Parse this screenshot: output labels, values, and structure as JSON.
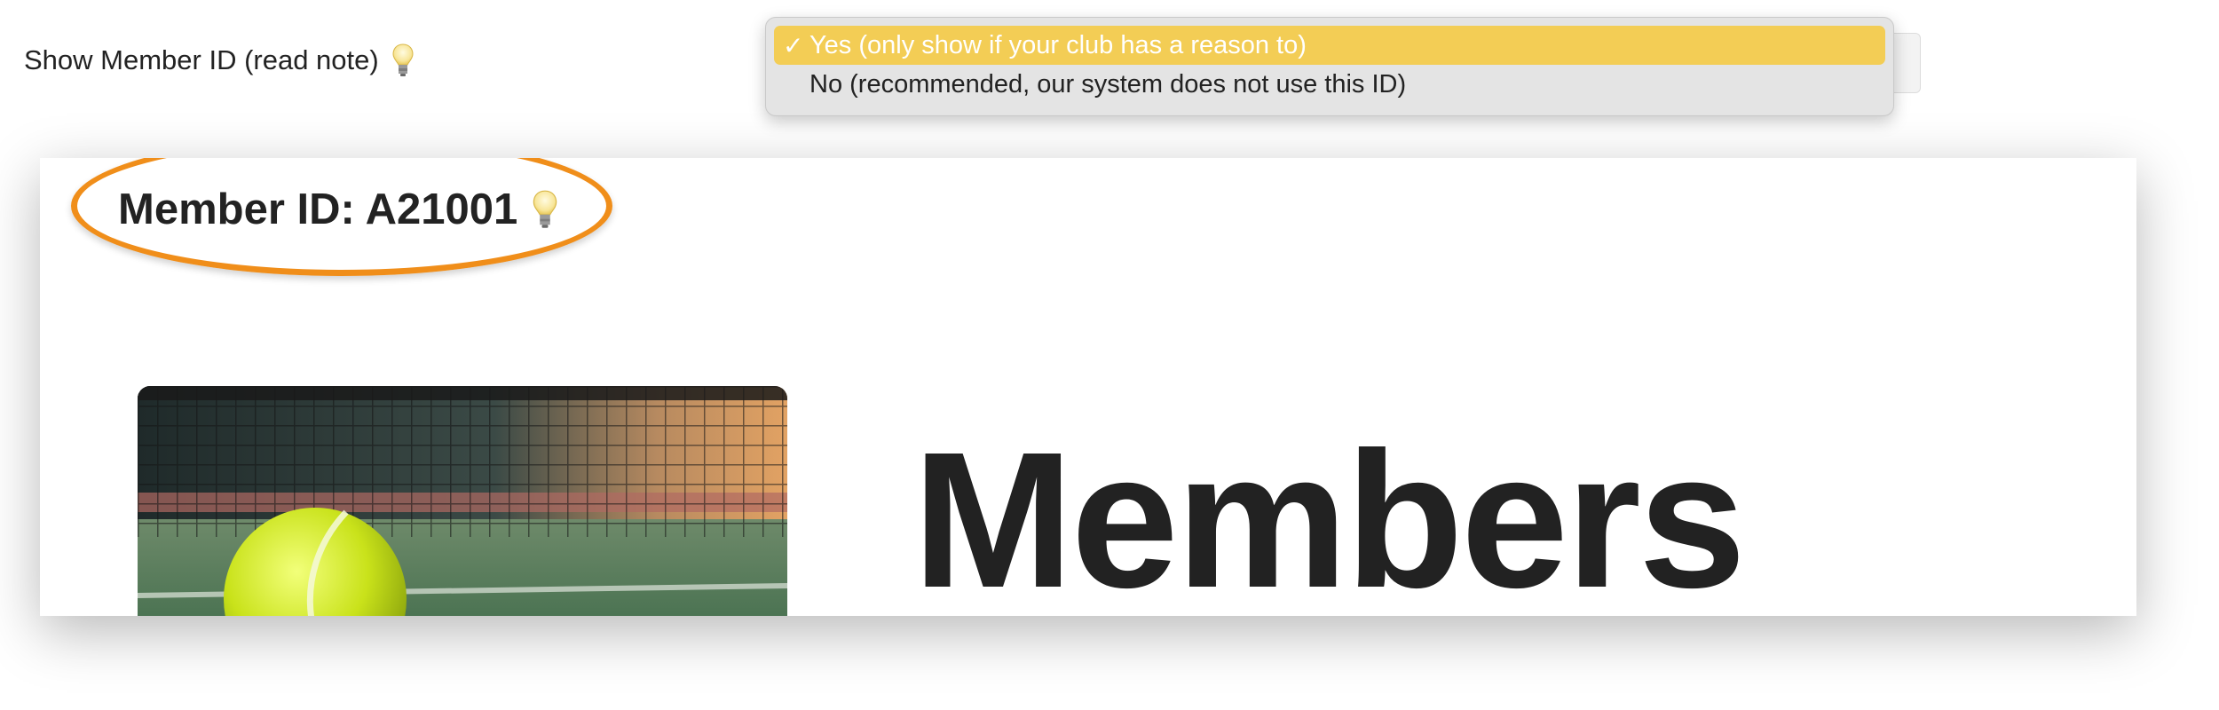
{
  "setting": {
    "label": "Show Member ID (read note)",
    "info_icon": "lightbulb-icon"
  },
  "dropdown": {
    "selected_index": 0,
    "check_mark": "✓",
    "options": [
      {
        "label": "Yes (only show if your club has a reason to)",
        "selected": true
      },
      {
        "label": "No (recommended, our system does not use this ID)",
        "selected": false
      }
    ],
    "highlight_color": "#F3CD55"
  },
  "preview": {
    "member_id_text": "Member ID: A21001",
    "member_id_icon": "lightbulb-icon",
    "annotation_color": "#F08E1A",
    "image_icon": "tennis-ball-net-photo",
    "heading": "Members"
  }
}
